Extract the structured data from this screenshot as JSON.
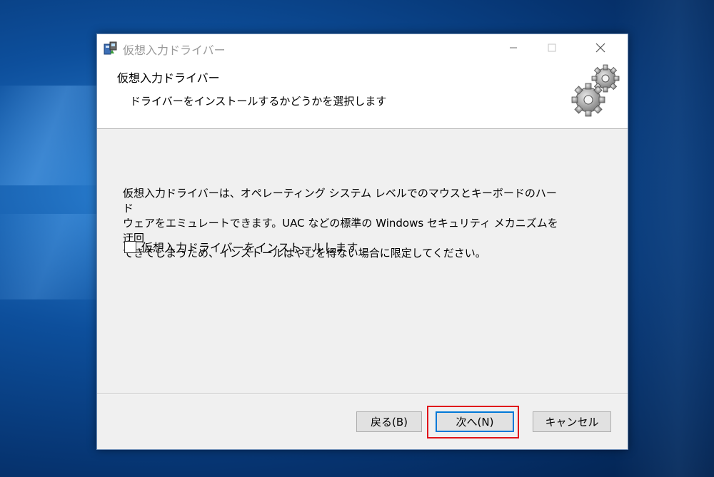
{
  "window": {
    "title": "仮想入力ドライバー"
  },
  "header": {
    "title": "仮想入力ドライバー",
    "subtitle": "ドライバーをインストールするかどうかを選択します"
  },
  "content": {
    "description": "仮想入力ドライバーは、オペレーティング システム レベルでのマウスとキーボードのハード\nウェアをエミュレートできます。UAC などの標準の Windows セキュリティ メカニズムを迂回\nできてしまうため、インストールはやむを得ない場合に限定してください。",
    "checkbox_label": "仮想入力ドライバーをインストールします",
    "checkbox_checked": false
  },
  "buttons": {
    "back": "戻る(B)",
    "next": "次へ(N)",
    "cancel": "キャンセル"
  },
  "icons": {
    "app": "installer-icon",
    "header": "gears-icon",
    "minimize": "minimize-icon",
    "maximize": "maximize-icon",
    "close": "close-icon"
  },
  "colors": {
    "highlight": "#e0141a",
    "default_button_border": "#0078d7"
  }
}
